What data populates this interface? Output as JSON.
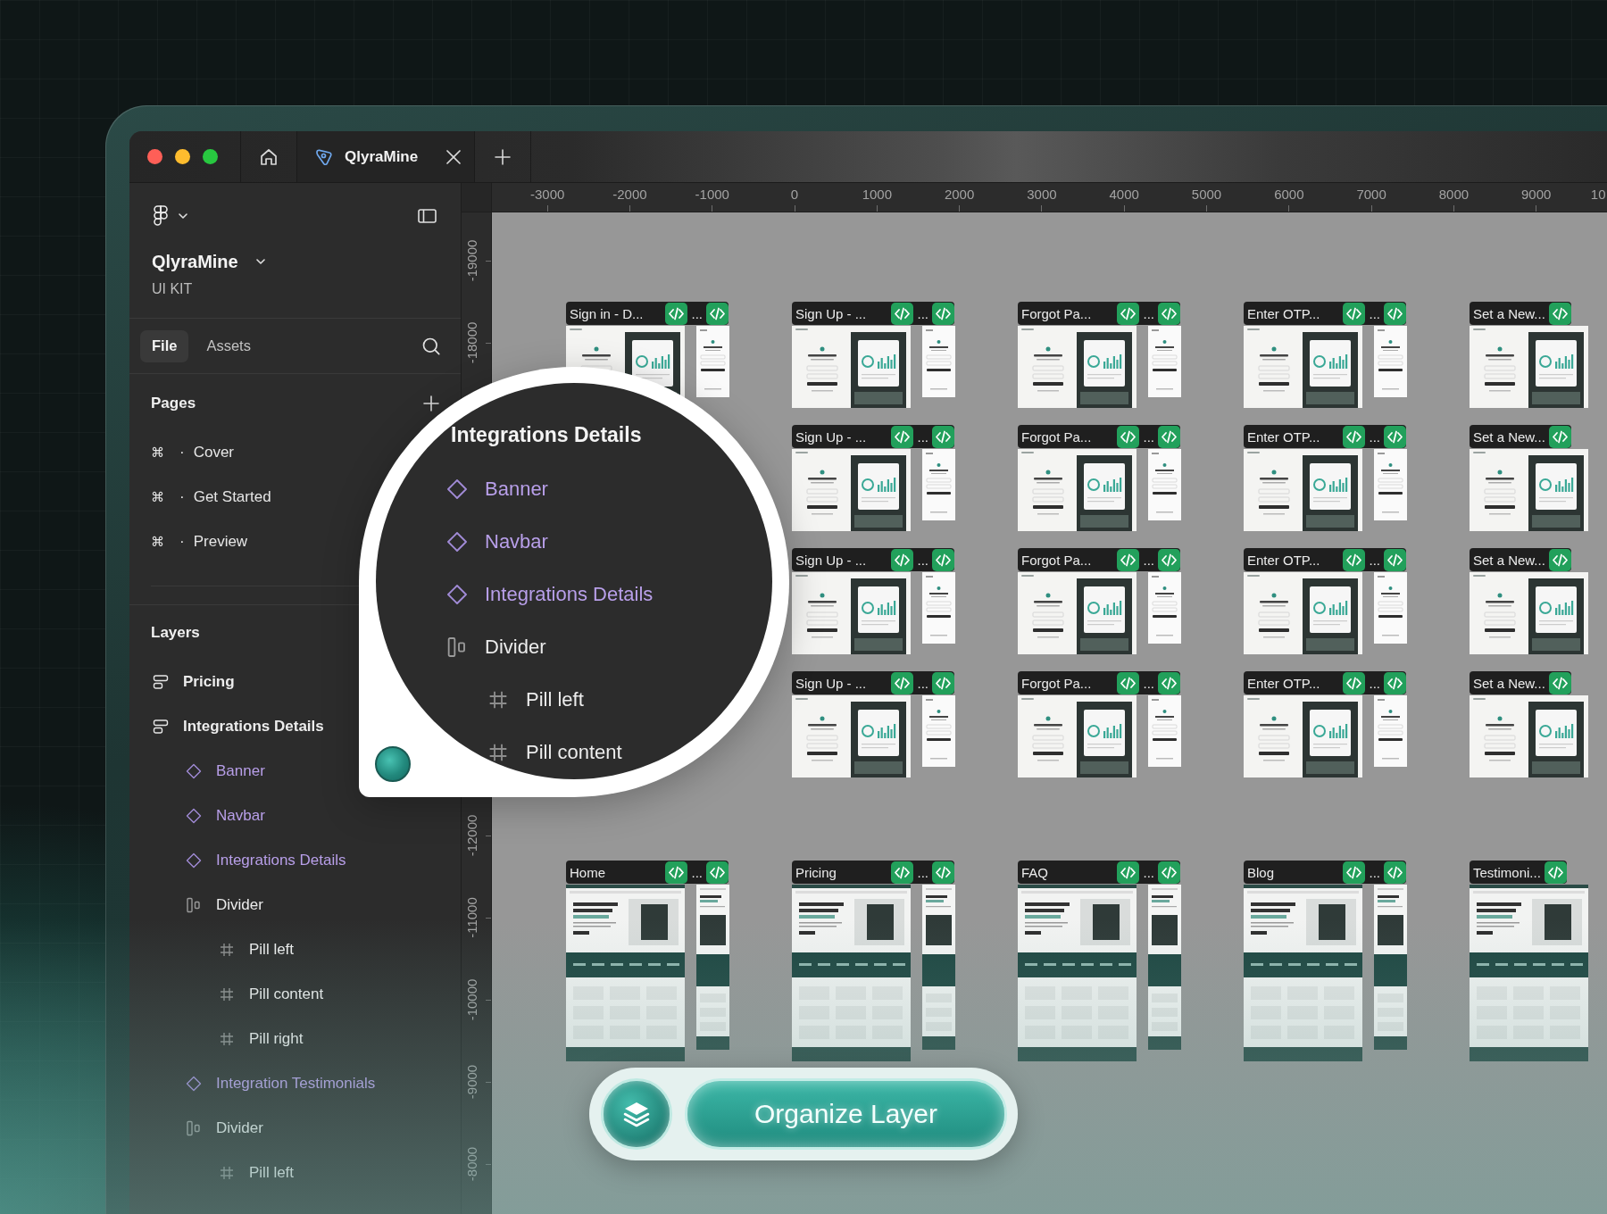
{
  "tabs": [
    {
      "label": "QlyraMine",
      "selected": true
    }
  ],
  "sidebar": {
    "project": {
      "name": "QlyraMine",
      "subtitle": "UI KIT"
    },
    "panel_tabs": [
      {
        "label": "File",
        "selected": true
      },
      {
        "label": "Assets",
        "selected": false
      }
    ],
    "pages_heading": "Pages",
    "pages": [
      {
        "symbol": "⌘",
        "separator": "·",
        "label": "Cover"
      },
      {
        "symbol": "⌘",
        "separator": "·",
        "label": "Get Started"
      },
      {
        "symbol": "⌘",
        "separator": "·",
        "label": "Preview"
      }
    ],
    "layers_heading": "Layers",
    "layers": [
      {
        "kind": "section",
        "label": "Pricing"
      },
      {
        "kind": "section",
        "label": "Integrations Details",
        "children": [
          {
            "kind": "component",
            "label": "Banner"
          },
          {
            "kind": "component",
            "label": "Navbar"
          },
          {
            "kind": "component",
            "label": "Integrations Details"
          },
          {
            "kind": "auto_layout",
            "label": "Divider",
            "children": [
              {
                "kind": "frame",
                "label": "Pill left"
              },
              {
                "kind": "frame",
                "label": "Pill content"
              },
              {
                "kind": "frame",
                "label": "Pill right"
              }
            ]
          },
          {
            "kind": "component",
            "label": "Integration Testimonials"
          },
          {
            "kind": "auto_layout",
            "label": "Divider",
            "children": [
              {
                "kind": "frame",
                "label": "Pill left"
              }
            ]
          }
        ]
      }
    ]
  },
  "rulers": {
    "horizontal": [
      "-3000",
      "-2000",
      "-1000",
      "0",
      "1000",
      "2000",
      "3000",
      "4000",
      "5000",
      "6000",
      "7000",
      "8000",
      "9000",
      "10"
    ],
    "vertical_upper": [
      "-19000",
      "-18000"
    ],
    "vertical_lower": [
      "-12000",
      "-11000",
      "-10000",
      "-9000",
      "-8000"
    ]
  },
  "canvas": {
    "rows": [
      {
        "kind": "screens",
        "frames": [
          {
            "kind": "frame",
            "title": "Sign in - D...",
            "mobile_title": "..."
          },
          {
            "kind": "frame",
            "title": "Sign Up - ...",
            "mobile_title": "..."
          },
          {
            "kind": "frame",
            "title": "Forgot Pa...",
            "mobile_title": "..."
          },
          {
            "kind": "frame",
            "title": "Enter OTP...",
            "mobile_title": "..."
          },
          {
            "kind": "frame",
            "title": "Set a New..."
          }
        ]
      },
      {
        "kind": "screens",
        "frames": [
          {
            "kind": "covered"
          },
          {
            "kind": "frame",
            "title": "Sign Up - ...",
            "mobile_title": "..."
          },
          {
            "kind": "frame",
            "title": "Forgot Pa...",
            "mobile_title": "..."
          },
          {
            "kind": "frame",
            "title": "Enter OTP...",
            "mobile_title": "..."
          },
          {
            "kind": "frame",
            "title": "Set a New..."
          }
        ]
      },
      {
        "kind": "screens",
        "frames": [
          {
            "kind": "covered"
          },
          {
            "kind": "frame",
            "title": "Sign Up - ...",
            "mobile_title": "..."
          },
          {
            "kind": "frame",
            "title": "Forgot Pa...",
            "mobile_title": "..."
          },
          {
            "kind": "frame",
            "title": "Enter OTP...",
            "mobile_title": "..."
          },
          {
            "kind": "frame",
            "title": "Set a New..."
          }
        ]
      },
      {
        "kind": "screens",
        "frames": [
          {
            "kind": "covered"
          },
          {
            "kind": "frame",
            "title": "Sign Up - ...",
            "mobile_title": "..."
          },
          {
            "kind": "frame",
            "title": "Forgot Pa...",
            "mobile_title": "..."
          },
          {
            "kind": "frame",
            "title": "Enter OTP...",
            "mobile_title": "..."
          },
          {
            "kind": "frame",
            "title": "Set a New..."
          }
        ]
      },
      {
        "kind": "pages",
        "frames": [
          {
            "kind": "frame",
            "title": "Home",
            "mobile_title": "..."
          },
          {
            "kind": "frame",
            "title": "Pricing",
            "mobile_title": "..."
          },
          {
            "kind": "frame",
            "title": "FAQ",
            "mobile_title": "..."
          },
          {
            "kind": "frame",
            "title": "Blog",
            "mobile_title": "..."
          },
          {
            "kind": "frame",
            "title": "Testimoni..."
          }
        ]
      }
    ]
  },
  "magnifier": {
    "heading": "Integrations Details",
    "layers": [
      {
        "kind": "component",
        "label": "Banner"
      },
      {
        "kind": "component",
        "label": "Navbar"
      },
      {
        "kind": "component",
        "label": "Integrations Details"
      },
      {
        "kind": "auto_layout",
        "label": "Divider",
        "children": [
          {
            "kind": "frame",
            "label": "Pill left"
          },
          {
            "kind": "frame",
            "label": "Pill content"
          }
        ]
      }
    ]
  },
  "action_button": {
    "label": "Organize Layer"
  }
}
